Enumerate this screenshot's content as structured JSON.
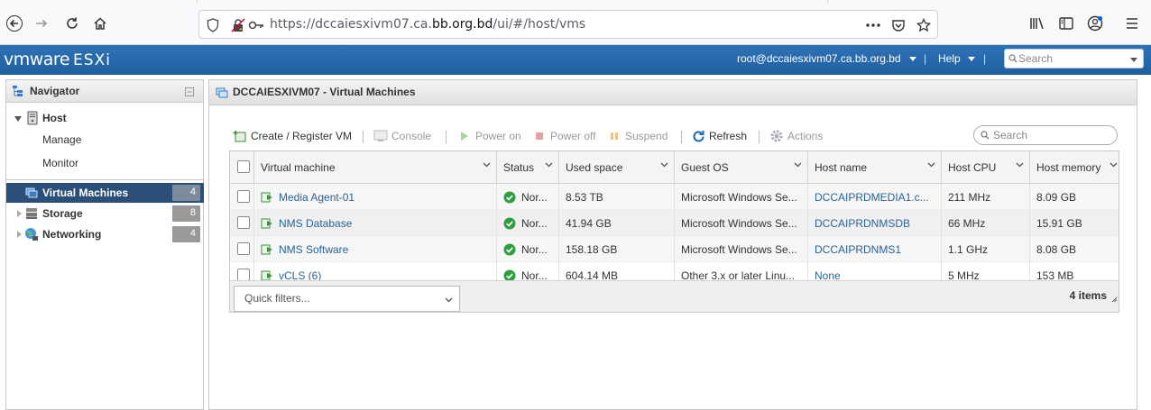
{
  "browser": {
    "url_prefix": "https://dccaiesxivm07.ca.",
    "url_domain": "bb.org.bd",
    "url_suffix": "/ui/#/host/vms"
  },
  "header": {
    "logo_vm": "vmware",
    "logo_product": "ESXi",
    "user": "root@dccaiesxivm07.ca.bb.org.bd",
    "help": "Help",
    "search_placeholder": "Search"
  },
  "navigator": {
    "title": "Navigator",
    "items": [
      {
        "label": "Host",
        "icon": "host-icon"
      },
      {
        "label": "Manage"
      },
      {
        "label": "Monitor"
      },
      {
        "label": "Virtual Machines",
        "badge": "4",
        "icon": "vms-icon"
      },
      {
        "label": "Storage",
        "badge": "8",
        "icon": "storage-icon"
      },
      {
        "label": "Networking",
        "badge": "4",
        "icon": "network-icon"
      }
    ]
  },
  "main": {
    "title": "DCCAIESXIVM07 - Virtual Machines",
    "toolbar": {
      "create": "Create / Register VM",
      "console": "Console",
      "power_on": "Power on",
      "power_off": "Power off",
      "suspend": "Suspend",
      "refresh": "Refresh",
      "actions": "Actions"
    },
    "search_placeholder": "Search",
    "columns": [
      "Virtual machine",
      "Status",
      "Used space",
      "Guest OS",
      "Host name",
      "Host CPU",
      "Host memory"
    ],
    "rows": [
      {
        "name": "Media Agent-01",
        "status": "Nor...",
        "used": "8.53 TB",
        "os": "Microsoft Windows Se...",
        "host": "DCCAIPRDMEDIA1.c...",
        "cpu": "211 MHz",
        "mem": "8.09 GB"
      },
      {
        "name": "NMS Database",
        "status": "Nor...",
        "used": "41.94 GB",
        "os": "Microsoft Windows Se...",
        "host": "DCCAIPRDNMSDB",
        "cpu": "66 MHz",
        "mem": "15.91 GB"
      },
      {
        "name": "NMS Software",
        "status": "Nor...",
        "used": "158.18 GB",
        "os": "Microsoft Windows Se...",
        "host": "DCCAIPRDNMS1",
        "cpu": "1.1 GHz",
        "mem": "8.08 GB"
      },
      {
        "name": "vCLS (6)",
        "status": "Nor...",
        "used": "604.14 MB",
        "os": "Other 3.x or later Linu...",
        "host": "None",
        "cpu": "5 MHz",
        "mem": "153 MB"
      }
    ],
    "quick_filters": "Quick filters...",
    "items_count": "4 items"
  }
}
